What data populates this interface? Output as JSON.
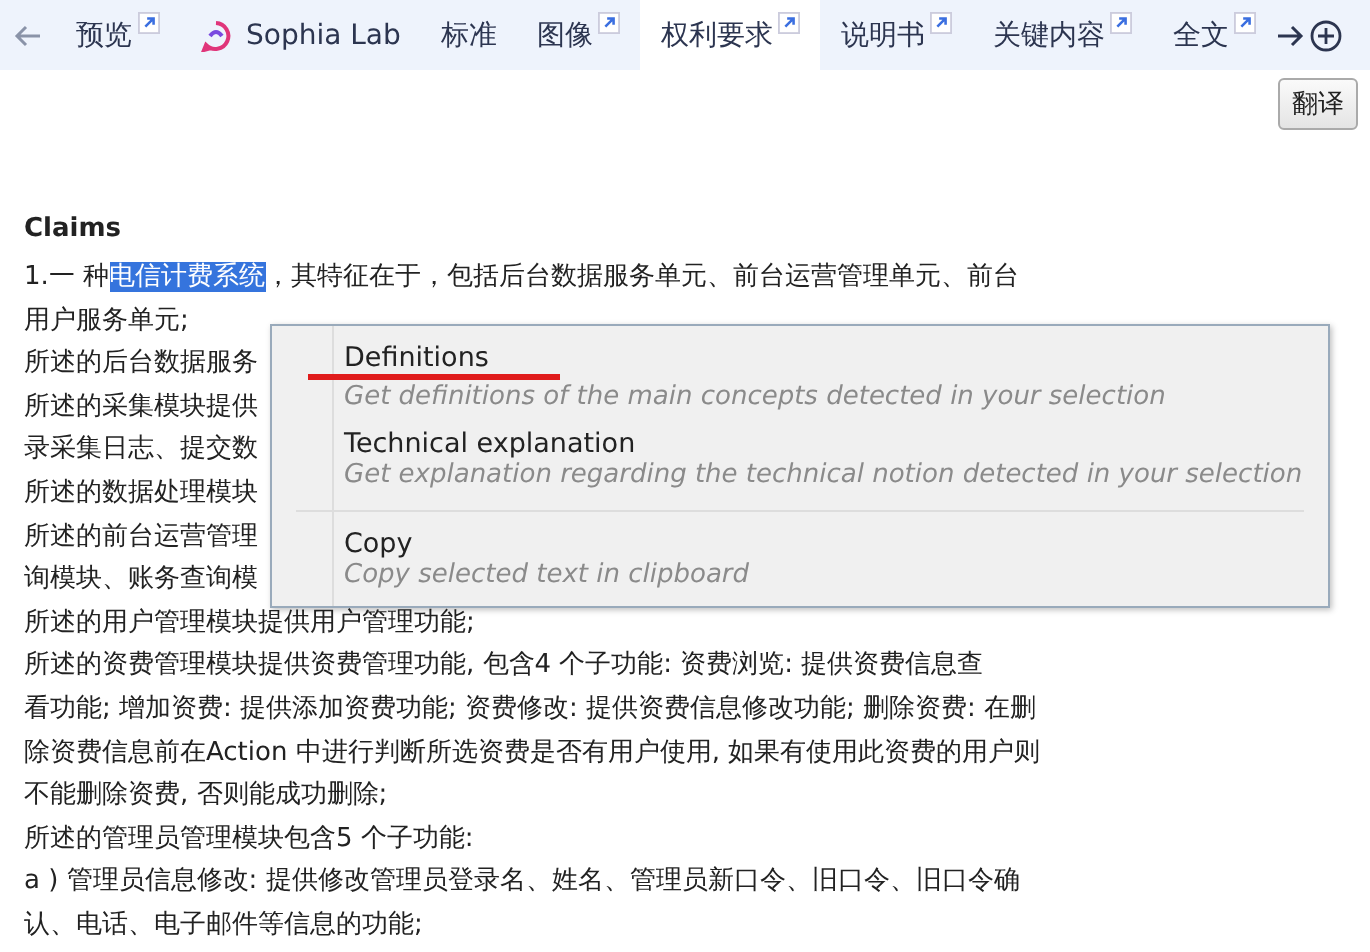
{
  "tabs": [
    {
      "label": "预览",
      "kind": "plain",
      "external": true,
      "selected": false
    },
    {
      "label": "Sophia Lab",
      "kind": "logo",
      "external": false,
      "selected": false
    },
    {
      "label": "标准",
      "kind": "plain",
      "external": false,
      "selected": false
    },
    {
      "label": "图像",
      "kind": "plain",
      "external": true,
      "selected": false
    },
    {
      "label": "权利要求",
      "kind": "plain",
      "external": true,
      "selected": true
    },
    {
      "label": "说明书",
      "kind": "plain",
      "external": true,
      "selected": false
    },
    {
      "label": "关键内容",
      "kind": "plain",
      "external": true,
      "selected": false
    },
    {
      "label": "全文",
      "kind": "plain",
      "external": true,
      "selected": false
    }
  ],
  "translate_button": "翻译",
  "document": {
    "heading": "Claims",
    "lines": [
      {
        "before": "1.一 种",
        "selection": "电信计费系统",
        "after": "，其特征在于，包括后台数据服务单元、前台运营管理单元、前台"
      },
      "用户服务单元;",
      "所述的后台数据服务",
      "所述的采集模块提供",
      "录采集日志、提交数",
      "所述的数据处理模块",
      "所述的前台运营管理",
      "询模块、账务查询模",
      "所述的用户管理模块提供用户管理功能;",
      "所述的资费管理模块提供资费管理功能, 包含4 个子功能: 资费浏览: 提供资费信息查",
      "看功能; 增加资费: 提供添加资费功能; 资费修改: 提供资费信息修改功能; 删除资费: 在删",
      "除资费信息前在Action 中进行判断所选资费是否有用户使用, 如果有使用此资费的用户则",
      "不能删除资费, 否则能成功删除;",
      "所述的管理员管理模块包含5 个子功能:",
      "a ) 管理员信息修改: 提供修改管理员登录名、姓名、管理员新口令、旧口令、旧口令确",
      "认、电话、电子邮件等信息的功能;"
    ]
  },
  "context_menu": {
    "items": [
      {
        "title": "Definitions",
        "description": "Get definitions of the main concepts detected in your selection",
        "underlined": true,
        "separator_before": false
      },
      {
        "title": "Technical explanation",
        "description": "Get explanation regarding the technical notion detected in your selection",
        "underlined": false,
        "separator_before": false
      },
      {
        "title": "Copy",
        "description": "Copy selected text in clipboard",
        "underlined": false,
        "separator_before": true
      }
    ]
  }
}
